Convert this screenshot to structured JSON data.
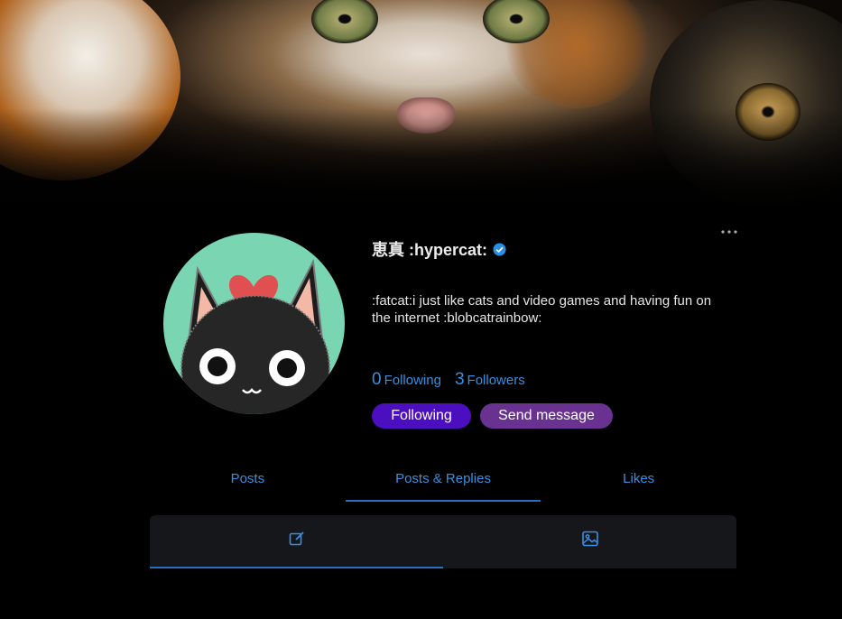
{
  "profile": {
    "display_name": "恵真 :hypercat:",
    "verified": true,
    "bio": ":fatcat:i just like cats and video games and having fun on the internet :blobcatrainbow:",
    "following_count": "0",
    "following_label": "Following",
    "followers_count": "3",
    "followers_label": "Followers"
  },
  "actions": {
    "following_button": "Following",
    "message_button": "Send message",
    "more_icon": "more-horizontal-icon"
  },
  "tabs": [
    {
      "label": "Posts",
      "active": false
    },
    {
      "label": "Posts & Replies",
      "active": true
    },
    {
      "label": "Likes",
      "active": false
    }
  ],
  "subtabs": [
    {
      "icon": "compose-icon",
      "active": true
    },
    {
      "icon": "image-icon",
      "active": false
    }
  ],
  "colors": {
    "accent": "#3a8fe0",
    "following_button": "#4c0fbf",
    "message_button": "#6a3290",
    "avatar_bg": "#7ad6b2",
    "verified_badge": "#2b8ee0"
  }
}
